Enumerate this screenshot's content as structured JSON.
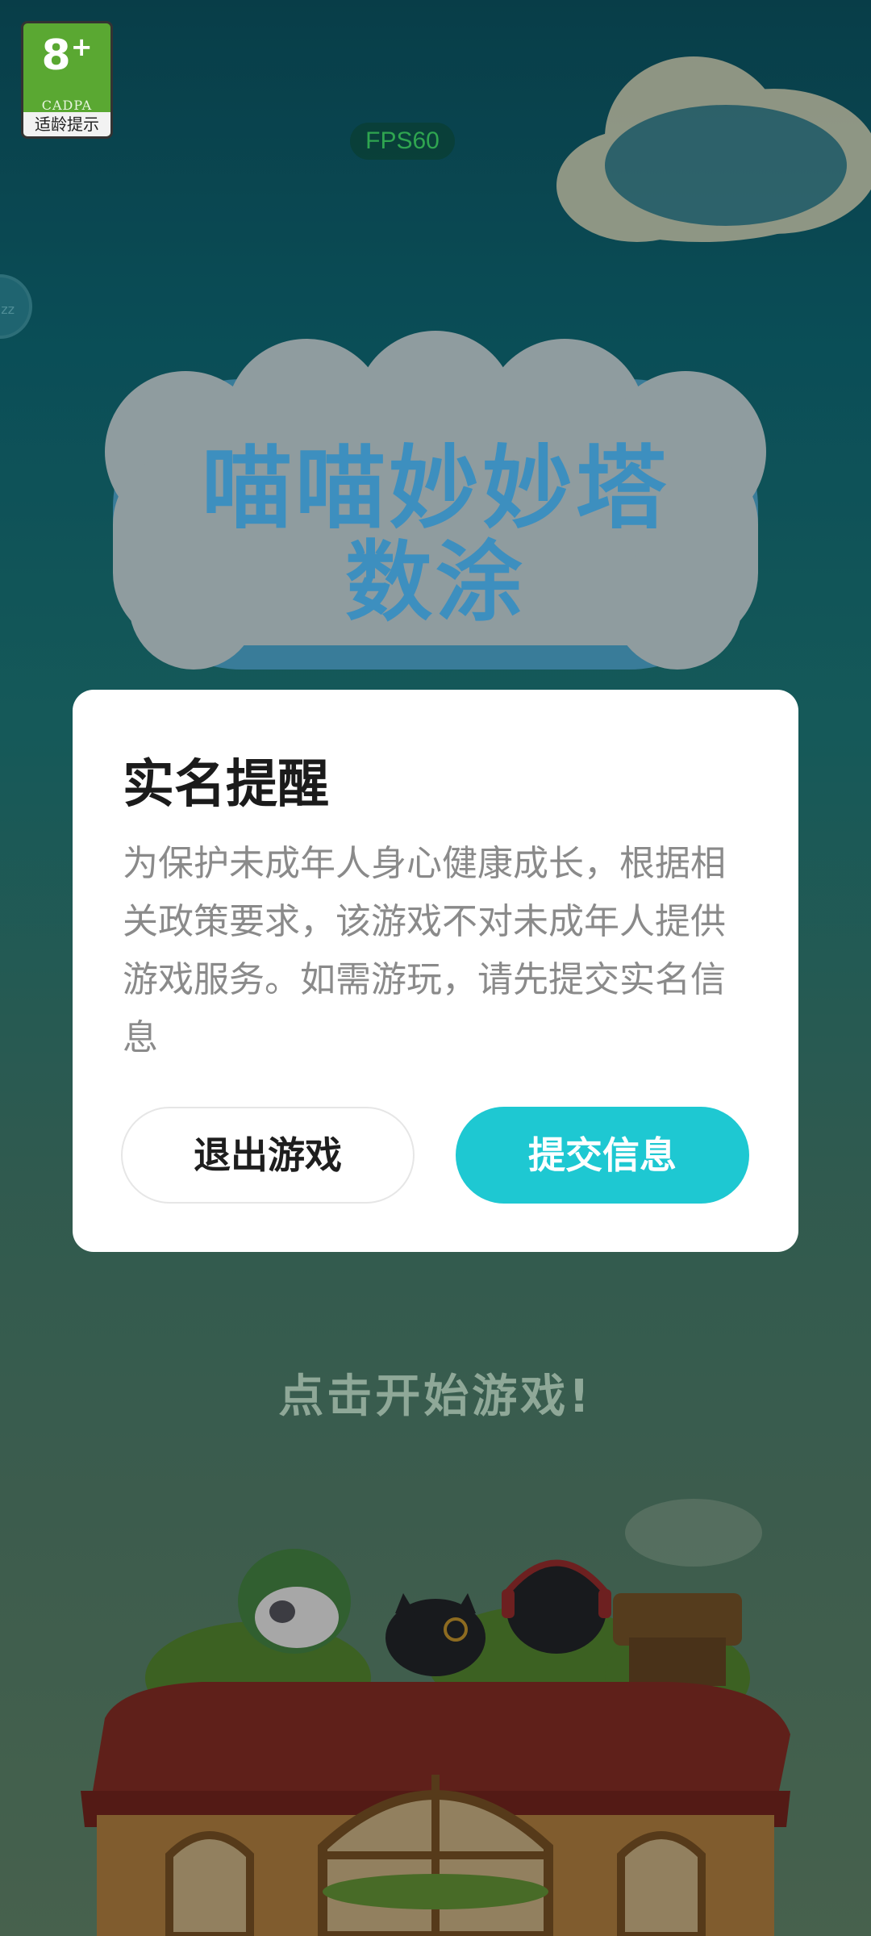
{
  "age_badge": {
    "rating": "8",
    "plus": "+",
    "org": "CADPA",
    "note": "适龄提示"
  },
  "fps_label": "FPS60",
  "side_button_label": "zz",
  "game_title": {
    "line1": "喵喵妙妙塔",
    "line2": "数涂"
  },
  "tap_to_start": "点击开始游戏!",
  "dialog": {
    "title": "实名提醒",
    "body": "为保护未成年人身心健康成长，根据相关政策要求，该游戏不对未成年人提供游戏服务。如需游玩，请先提交实名信息",
    "exit_label": "退出游戏",
    "submit_label": "提交信息"
  },
  "colors": {
    "accent": "#1ec8d2",
    "title_text": "#3d8fbf",
    "fps_text": "#2fa550"
  }
}
